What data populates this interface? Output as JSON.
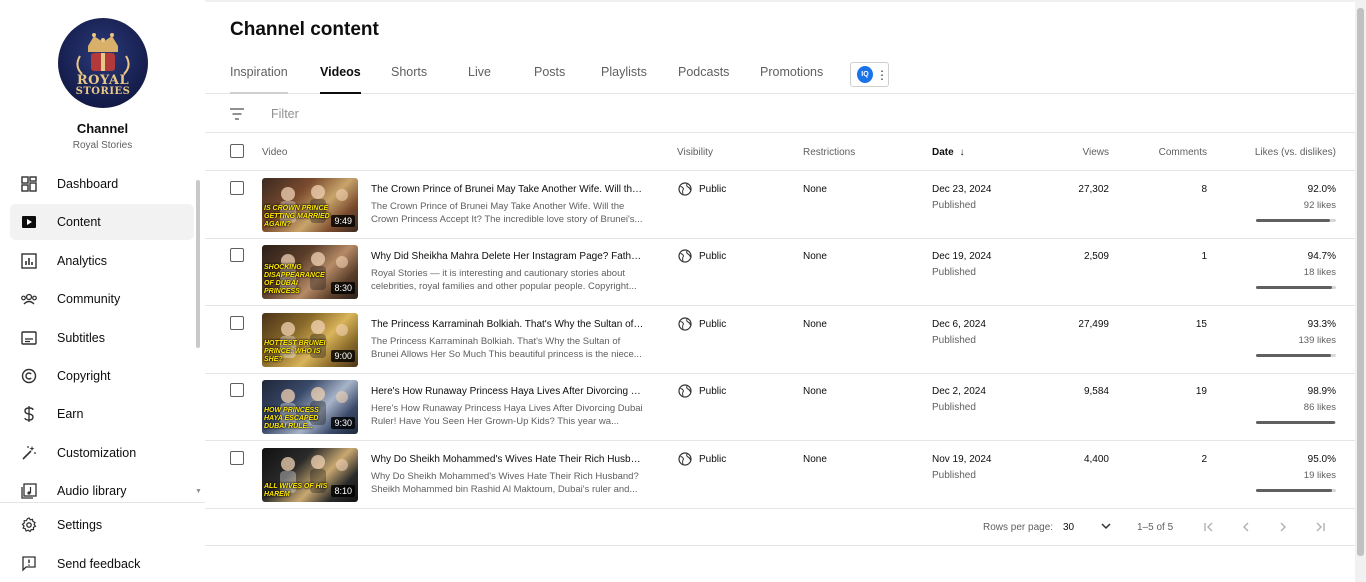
{
  "sidebar": {
    "channel_title": "Channel",
    "channel_name": "Royal Stories",
    "avatar_text_line1": "ROYAL",
    "avatar_text_line2": "STORIES",
    "items": [
      {
        "label": "Dashboard",
        "icon": "dashboard-icon"
      },
      {
        "label": "Content",
        "icon": "content-icon",
        "active": true
      },
      {
        "label": "Analytics",
        "icon": "analytics-icon"
      },
      {
        "label": "Community",
        "icon": "community-icon"
      },
      {
        "label": "Subtitles",
        "icon": "subtitles-icon"
      },
      {
        "label": "Copyright",
        "icon": "copyright-icon"
      },
      {
        "label": "Earn",
        "icon": "earn-icon"
      },
      {
        "label": "Customization",
        "icon": "customization-icon"
      },
      {
        "label": "Audio library",
        "icon": "audio-library-icon"
      }
    ],
    "bottom_items": [
      {
        "label": "Settings",
        "icon": "gear-icon"
      },
      {
        "label": "Send feedback",
        "icon": "feedback-icon"
      }
    ]
  },
  "main": {
    "title": "Channel content",
    "tabs": [
      "Inspiration",
      "Videos",
      "Shorts",
      "Live",
      "Posts",
      "Playlists",
      "Podcasts",
      "Promotions"
    ],
    "active_tab": "Videos",
    "extension_badge": "IQ",
    "filter_placeholder": "Filter",
    "columns": {
      "video": "Video",
      "visibility": "Visibility",
      "restrictions": "Restrictions",
      "date": "Date",
      "views": "Views",
      "comments": "Comments",
      "likes": "Likes (vs. dislikes)"
    },
    "rows": [
      {
        "title": "The Crown Prince of Brunei May Take Another Wife. Will the Crown Princess Accept It?",
        "description": "The Crown Prince of Brunei May Take Another Wife. Will the Crown Princess Accept It? The incredible love story of Brunei's...",
        "thumb_caption": "IS CROWN PRINCE GETTING MARRIED AGAIN?",
        "duration": "9:49",
        "visibility": "Public",
        "restrictions": "None",
        "date": "Dec 23, 2024",
        "date_status": "Published",
        "views": "27,302",
        "comments": "8",
        "likes_pct": "92.0%",
        "likes_count": "92 likes",
        "likes_fraction": 0.92,
        "thumb_colors": [
          "#7a4a2e",
          "#c8a46a",
          "#3a2a20"
        ]
      },
      {
        "title": "Why Did Sheikha Mahra Delete Her Instagram Page? Father Sheikh Mohammed's Reaction",
        "description": "Royal Stories — it is interesting and cautionary stories about celebrities, royal families and other popular people. Copyright...",
        "thumb_caption": "SHOCKING DISAPPEARANCE OF DUBAI PRINCESS",
        "duration": "8:30",
        "visibility": "Public",
        "restrictions": "None",
        "date": "Dec 19, 2024",
        "date_status": "Published",
        "views": "2,509",
        "comments": "1",
        "likes_pct": "94.7%",
        "likes_count": "18 likes",
        "likes_fraction": 0.947,
        "thumb_colors": [
          "#5a3e2a",
          "#b58a66",
          "#2a1e18"
        ]
      },
      {
        "title": "The Princess Karraminah Bolkiah. That's Why the Sultan of Brunei Allows Her So Much",
        "description": "The Princess Karraminah Bolkiah. That's Why the Sultan of Brunei Allows Her So Much This beautiful princess is the niece...",
        "thumb_caption": "HOTTEST BRUNEI PRINCE: WHO IS SHE?",
        "duration": "9:00",
        "visibility": "Public",
        "restrictions": "None",
        "date": "Dec 6, 2024",
        "date_status": "Published",
        "views": "27,499",
        "comments": "15",
        "likes_pct": "93.3%",
        "likes_count": "139 likes",
        "likes_fraction": 0.933,
        "thumb_colors": [
          "#8a6a2a",
          "#d9b45a",
          "#4a3218"
        ]
      },
      {
        "title": "Here's How Runaway Princess Haya Lives After Divorcing Dubai Ruler!",
        "description": "Here's How Runaway Princess Haya Lives After Divorcing Dubai Ruler! Have You Seen Her Grown-Up Kids? This year wa...",
        "thumb_caption": "HOW PRINCESS HAYA ESCAPED DUBAI RULE...",
        "duration": "9:30",
        "visibility": "Public",
        "restrictions": "None",
        "date": "Dec 2, 2024",
        "date_status": "Published",
        "views": "9,584",
        "comments": "19",
        "likes_pct": "98.9%",
        "likes_count": "86 likes",
        "likes_fraction": 0.989,
        "thumb_colors": [
          "#3a4a6a",
          "#a8b4c8",
          "#1e2638"
        ]
      },
      {
        "title": "Why Do Sheikh Mohammed's Wives Hate Their Rich Husband?",
        "description": "Why Do Sheikh Mohammed's Wives Hate Their Rich Husband? Sheikh Mohammed bin Rashid Al Maktoum, Dubai's ruler and...",
        "thumb_caption": "ALL WIVES OF HIS HAREM",
        "duration": "8:10",
        "visibility": "Public",
        "restrictions": "None",
        "date": "Nov 19, 2024",
        "date_status": "Published",
        "views": "4,400",
        "comments": "2",
        "likes_pct": "95.0%",
        "likes_count": "19 likes",
        "likes_fraction": 0.95,
        "thumb_colors": [
          "#2a2a2a",
          "#c8a870",
          "#111111"
        ]
      }
    ],
    "pagination": {
      "rows_per_page_label": "Rows per page:",
      "rows_per_page_value": "30",
      "range": "1–5 of 5"
    }
  }
}
